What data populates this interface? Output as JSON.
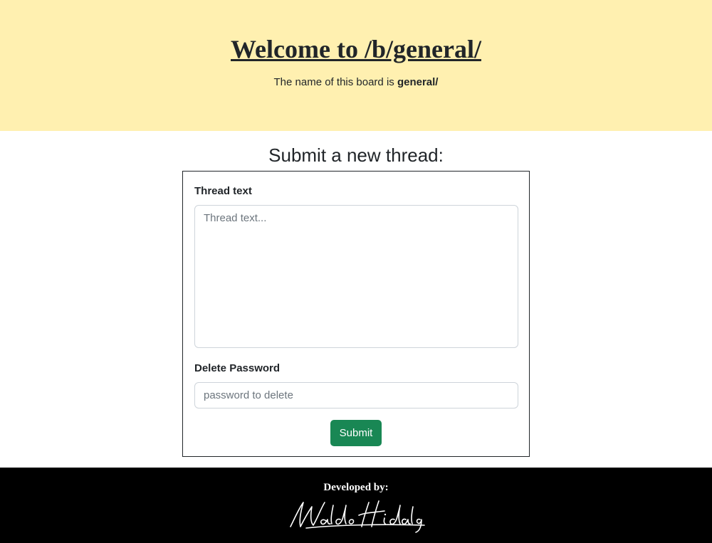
{
  "header": {
    "title": "Welcome to /b/general/",
    "subtitle_prefix": "The name of this board is ",
    "board_name": "general/"
  },
  "form": {
    "heading": "Submit a new thread:",
    "thread_label": "Thread text",
    "thread_placeholder": "Thread text...",
    "password_label": "Delete Password",
    "password_placeholder": "password to delete",
    "submit_label": "Submit"
  },
  "footer": {
    "developed_by": "Developed by:",
    "signature_name": "Waldo Hidalgo"
  },
  "colors": {
    "header_bg": "#fff0b0",
    "button_bg": "#198754",
    "footer_bg": "#000000"
  }
}
